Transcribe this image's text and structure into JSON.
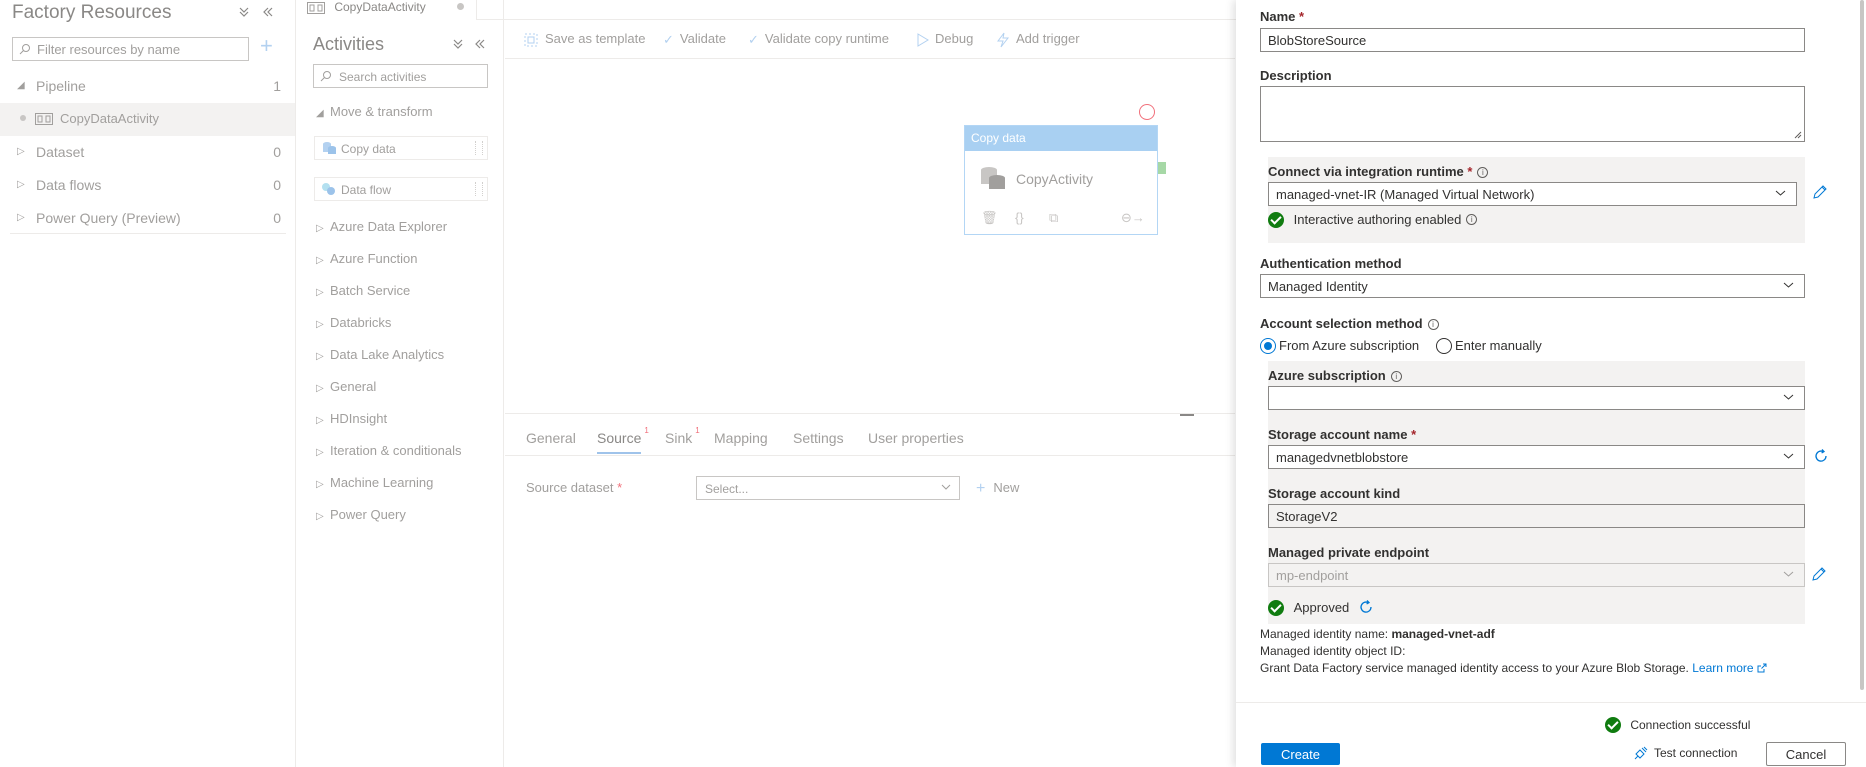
{
  "factory": {
    "title": "Factory Resources",
    "filter_placeholder": "Filter resources by name",
    "tree": [
      {
        "label": "Pipeline",
        "count": "1"
      },
      {
        "label": "CopyDataActivity"
      },
      {
        "label": "Dataset",
        "count": "0"
      },
      {
        "label": "Data flows",
        "count": "0"
      },
      {
        "label": "Power Query (Preview)",
        "count": "0"
      }
    ]
  },
  "doc_tab": {
    "label": "CopyDataActivity"
  },
  "activities": {
    "title": "Activities",
    "search_placeholder": "Search activities",
    "move_transform": "Move & transform",
    "items": [
      "Copy data",
      "Data flow"
    ],
    "groups": [
      "Azure Data Explorer",
      "Azure Function",
      "Batch Service",
      "Databricks",
      "Data Lake Analytics",
      "General",
      "HDInsight",
      "Iteration & conditionals",
      "Machine Learning",
      "Power Query"
    ]
  },
  "toolbar": {
    "save_template": "Save as template",
    "validate": "Validate",
    "validate_runtime": "Validate copy runtime",
    "debug": "Debug",
    "add_trigger": "Add trigger"
  },
  "node": {
    "header": "Copy data",
    "name": "CopyActivity"
  },
  "props": {
    "tabs": [
      "General",
      "Source",
      "Sink",
      "Mapping",
      "Settings",
      "User properties"
    ],
    "source_badge": "1",
    "sink_badge": "1",
    "source_dataset_label": "Source dataset",
    "select_placeholder": "Select...",
    "new_label": "New"
  },
  "panel": {
    "name_label": "Name",
    "name_value": "BlobStoreSource",
    "description_label": "Description",
    "description_value": "",
    "ir_label": "Connect via integration runtime",
    "ir_value": "managed-vnet-IR (Managed Virtual Network)",
    "interactive_authoring": "Interactive authoring enabled",
    "auth_label": "Authentication method",
    "auth_value": "Managed Identity",
    "account_selection_label": "Account selection method",
    "radio_azure": "From Azure subscription",
    "radio_manual": "Enter manually",
    "subscription_label": "Azure subscription",
    "subscription_value": "",
    "storage_name_label": "Storage account name",
    "storage_name_value": "managedvnetblobstore",
    "storage_kind_label": "Storage account kind",
    "storage_kind_value": "StorageV2",
    "endpoint_label": "Managed private endpoint",
    "endpoint_value": "mp-endpoint",
    "approved": "Approved",
    "mi_name_label": "Managed identity name:",
    "mi_name_value": "managed-vnet-adf",
    "mi_object_label": "Managed identity object ID:",
    "grant_text": "Grant Data Factory service managed identity access to your Azure Blob Storage.",
    "learn_more": "Learn more",
    "connection_status": "Connection successful",
    "create": "Create",
    "test_connection": "Test connection",
    "cancel": "Cancel"
  },
  "colors": {
    "accent": "#0078d4",
    "success": "#107c10",
    "required": "#a4262c"
  }
}
